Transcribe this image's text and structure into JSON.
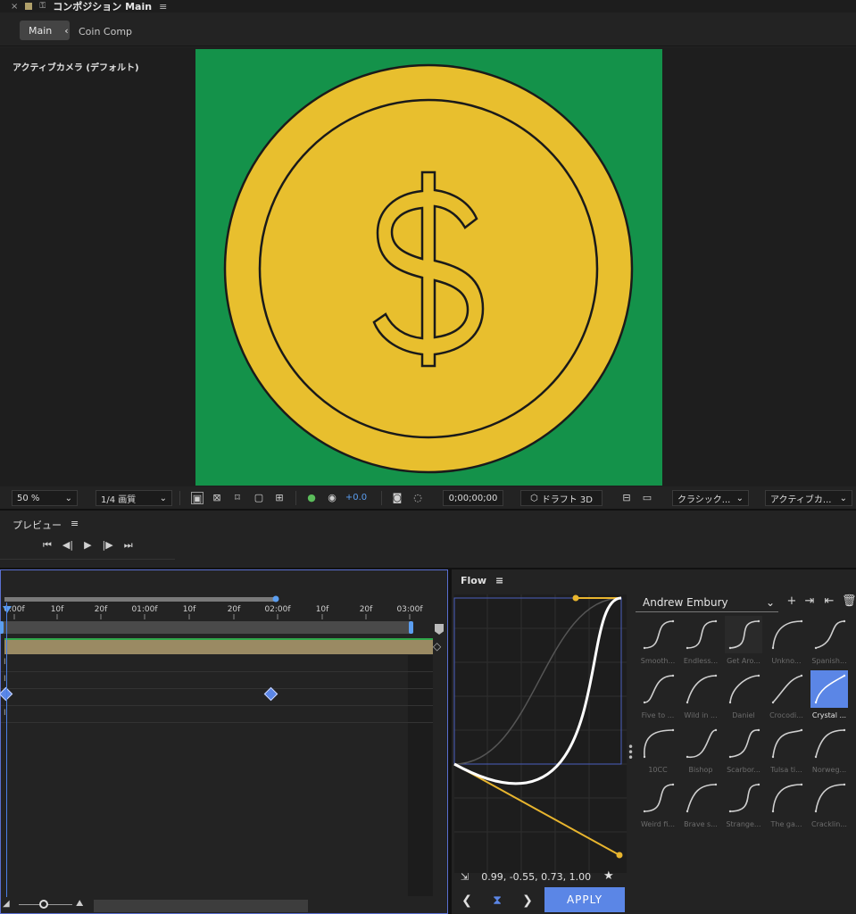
{
  "comp": {
    "close_label": "×",
    "title": "コンポジション Main",
    "menu_glyph": "≡",
    "breadcrumb": [
      {
        "label": "Main",
        "chevron": "‹"
      },
      {
        "label": "Coin Comp"
      }
    ],
    "camera_label": "アクティブカメラ (デフォルト)",
    "toolbar": {
      "zoom": "50 %",
      "resolution": "1/4 画質",
      "exposure": "+0.0",
      "timecode": "0;00;00;00",
      "renderer": "ドラフト 3D",
      "view_mode": "クラシック...",
      "camera": "アクティブカ..."
    }
  },
  "preview": {
    "title": "プレビュー",
    "menu_glyph": "≡",
    "controls": [
      "first-frame-icon",
      "prev-frame-icon",
      "play-icon",
      "next-frame-icon",
      "last-frame-icon"
    ]
  },
  "timeline": {
    "ruler_labels": [
      "0:00f",
      "10f",
      "20f",
      "01:00f",
      "10f",
      "20f",
      "02:00f",
      "10f",
      "20f",
      "03:00f"
    ],
    "keyframe_times": [
      "0:00f",
      "02:00f"
    ],
    "zoom_level": 0.5
  },
  "flow": {
    "title": "Flow",
    "menu_glyph": "≡",
    "preset_library": "Andrew Embury",
    "bezier_values": "0.99, -0.55, 0.73, 1.00",
    "apply_label": "APPLY",
    "presets": [
      {
        "label": "Smooth..."
      },
      {
        "label": "Endless..."
      },
      {
        "label": "Get Aro..."
      },
      {
        "label": "Unkno..."
      },
      {
        "label": "Spanish..."
      },
      {
        "label": "Five to ..."
      },
      {
        "label": "Wild in ..."
      },
      {
        "label": "Daniel"
      },
      {
        "label": "Crocodi..."
      },
      {
        "label": "Crystal ..."
      },
      {
        "label": "10CC"
      },
      {
        "label": "Bishop"
      },
      {
        "label": "Scarbor..."
      },
      {
        "label": "Tulsa ti..."
      },
      {
        "label": "Norweg..."
      },
      {
        "label": "Weird fi..."
      },
      {
        "label": "Brave s..."
      },
      {
        "label": "Strange..."
      },
      {
        "label": "The ga..."
      },
      {
        "label": "Cracklin..."
      }
    ],
    "selected_preset": "Crystal ...",
    "colors": {
      "accent": "#5b86e6",
      "handle": "#e8b52e",
      "curve": "#ffffff"
    }
  },
  "canvas": {
    "background": "#14924a",
    "coin_fill": "#e8bf2e",
    "symbol": "$"
  }
}
